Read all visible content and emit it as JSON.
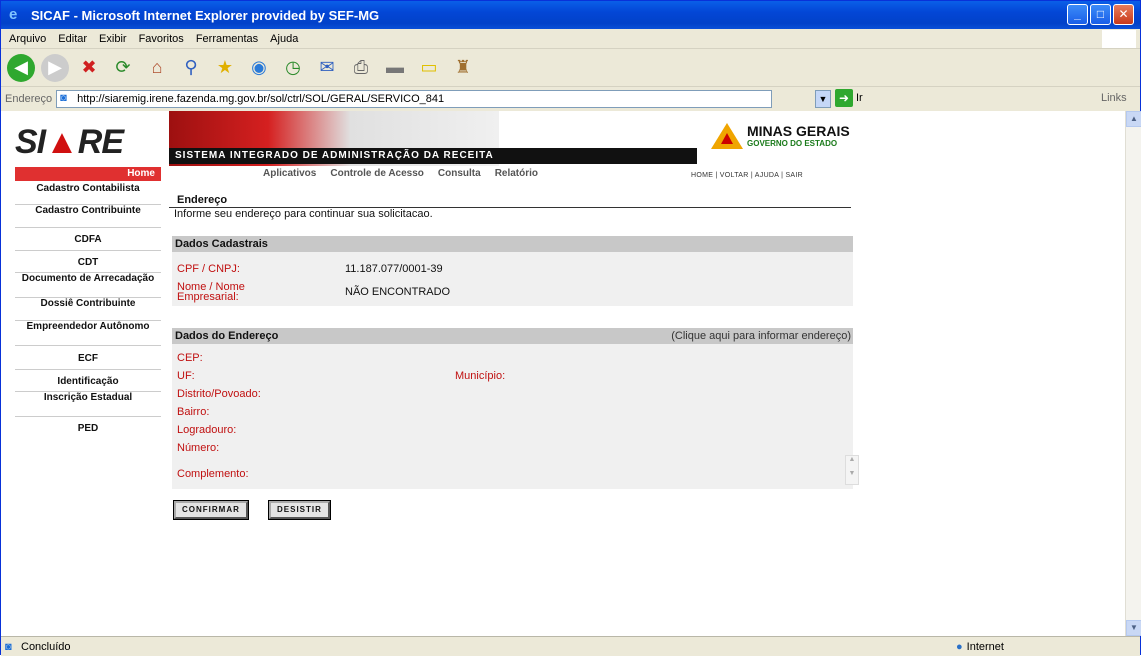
{
  "window": {
    "title": "SICAF - Microsoft Internet Explorer provided by SEF-MG"
  },
  "menubar": [
    "Arquivo",
    "Editar",
    "Exibir",
    "Favoritos",
    "Ferramentas",
    "Ajuda"
  ],
  "address": {
    "label": "Endereço",
    "url": "http://siaremig.irene.fazenda.mg.gov.br/sol/ctrl/SOL/GERAL/SERVICO_841",
    "go": "Ir",
    "links": "Links"
  },
  "header": {
    "logo_a": "SI",
    "logo_b": "▲",
    "logo_c": "RE",
    "tagline": "SISTEMA INTEGRADO DE ADMINISTRAÇÃO DA RECEITA",
    "mg_title": "MINAS GERAIS",
    "mg_sub": "GOVERNO DO ESTADO",
    "home": "Home",
    "toplinks": "HOME | VOLTAR | AJUDA | SAIR"
  },
  "topmenu": [
    "Aplicativos",
    "Controle de Acesso",
    "Consulta",
    "Relatório"
  ],
  "sidebar": [
    "Cadastro Contabilista",
    "Cadastro Contribuinte",
    "CDFA",
    "CDT",
    "Documento de Arrecadação",
    "Dossiê Contribuinte",
    "Empreendedor Autônomo",
    "ECF",
    "Identificação",
    "Inscrição Estadual",
    "PED"
  ],
  "page": {
    "title": "Endereço",
    "info": "Informe seu endereço para continuar sua solicitacao."
  },
  "dados_cadastrais": {
    "heading": "Dados Cadastrais",
    "cpf_label": "CPF / CNPJ:",
    "cpf_value": "11.187.077/0001-39",
    "nome_label_1": "Nome / Nome",
    "nome_label_2": "Empresarial:",
    "nome_value": "NÃO ENCONTRADO"
  },
  "dados_endereco": {
    "heading": "Dados do Endereço",
    "click": "(Clique aqui para informar endereço)",
    "cep": "CEP:",
    "uf": "UF:",
    "municipio": "Município:",
    "distrito": "Distrito/Povoado:",
    "bairro": "Bairro:",
    "logradouro": "Logradouro:",
    "numero": "Número:",
    "complemento": "Complemento:"
  },
  "buttons": {
    "confirmar": "CONFIRMAR",
    "desistir": "DESISTIR"
  },
  "status": {
    "text": "Concluído",
    "zone": "Internet"
  }
}
